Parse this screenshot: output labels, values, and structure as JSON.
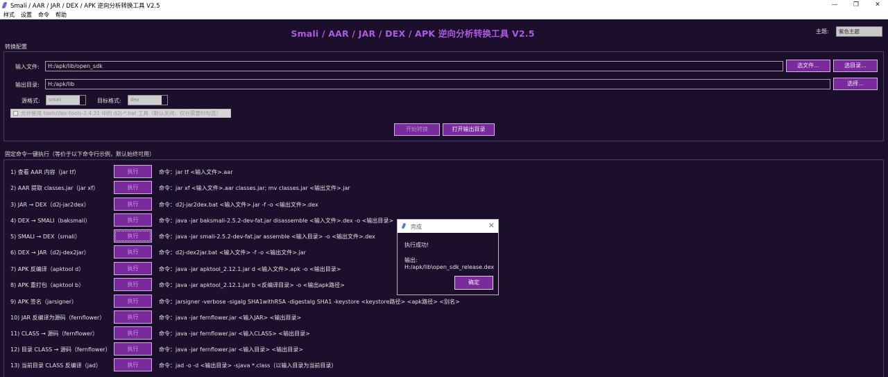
{
  "window": {
    "title": "Smali / AAR / JAR / DEX / APK 逆向分析转换工具 V2.5",
    "minimize": "—",
    "maximize": "❐",
    "close": "✕"
  },
  "menu": [
    "样式",
    "设置",
    "命令",
    "帮助"
  ],
  "header": {
    "title": "Smali / AAR / JAR / DEX / APK 逆向分析转换工具 V2.5",
    "theme_label": "主题:",
    "theme_value": "紫色主题"
  },
  "config": {
    "section_title": "转换配置",
    "input_file_label": "输入文件:",
    "input_file_value": "H:/apk/lib/open_sdk",
    "select_file_button": "选文件...",
    "select_dir_button": "选目录...",
    "output_dir_label": "输出目录:",
    "output_dir_value": "H:/apk/lib",
    "choose_button": "选择...",
    "source_format_label": "源格式:",
    "source_format_value": "smali",
    "target_format_label": "目标格式:",
    "target_format_value": "dex",
    "checkbox_label": "允许使用 tools/dex-tools-2.4.31 中的 d2j-*.bat 工具（默认关闭，仅在需要时勾选）",
    "start_button": "开始转换",
    "open_output_button": "打开输出目录"
  },
  "commands": {
    "section_title": "固定命令一键执行（等价于以下命令行示例，默认始终可用）",
    "run_label": "执行",
    "items": [
      {
        "label": "1) 查看 AAR 内容（jar tf）",
        "cmd": "命令：jar tf <输入文件>.aar"
      },
      {
        "label": "2) AAR 提取 classes.jar（jar xf）",
        "cmd": "命令：jar xf <输入文件>.aar classes.jar; mv classes.jar <输出文件>.jar"
      },
      {
        "label": "3) JAR → DEX（d2j-jar2dex）",
        "cmd": "命令：d2j-jar2dex.bat <输入文件>.jar -f -o <输出文件>.dex"
      },
      {
        "label": "4) DEX → SMALI（baksmali）",
        "cmd": "命令：java -jar baksmali-2.5.2-dev-fat.jar disassemble <输入文件>.dex -o <输出目录>"
      },
      {
        "label": "5) SMALI → DEX（smali）",
        "cmd": "命令：java -jar smali-2.5.2-dev-fat.jar assemble <输入目录> -o <输出文件>.dex"
      },
      {
        "label": "6) DEX → JAR（d2j-dex2jar）",
        "cmd": "命令：d2j-dex2jar.bat <输入文件> -f -o <输出文件>.jar"
      },
      {
        "label": "7) APK 反编译（apktool d）",
        "cmd": "命令：java -jar apktool_2.12.1.jar d <输入文件>.apk -o <输出目录>"
      },
      {
        "label": "8) APK 重打包（apktool b）",
        "cmd": "命令：java -jar apktool_2.12.1.jar b <反编译目录> -o <输出apk路径>"
      },
      {
        "label": "9) APK 签名（jarsigner）",
        "cmd": "命令：jarsigner -verbose -sigalg SHA1withRSA -digestalg SHA1 -keystore <keystore路径> <apk路径> <别名>"
      },
      {
        "label": "10) JAR 反编译为源码（fernflower）",
        "cmd": "命令：java -jar fernflower.jar <输入JAR> <输出目录>"
      },
      {
        "label": "11) CLASS → 源码（fernflower）",
        "cmd": "命令：java -jar fernflower.jar <输入CLASS> <输出目录>"
      },
      {
        "label": "12) 目录 CLASS → 源码（fernflower）",
        "cmd": "命令：java -jar fernflower.jar <输入目录> <输出目录>"
      },
      {
        "label": "13) 当前目录 CLASS 反编译（jad）",
        "cmd": "命令：jad -o -d <输出目录> -sjava *.class（以输入目录为当前目录）"
      }
    ]
  },
  "dialog": {
    "title": "完成",
    "close": "✕",
    "message": "执行成功!",
    "output_label": "输出:",
    "output_path": "H:/apk/lib\\open_sdk_release.dex",
    "ok_button": "确定"
  }
}
